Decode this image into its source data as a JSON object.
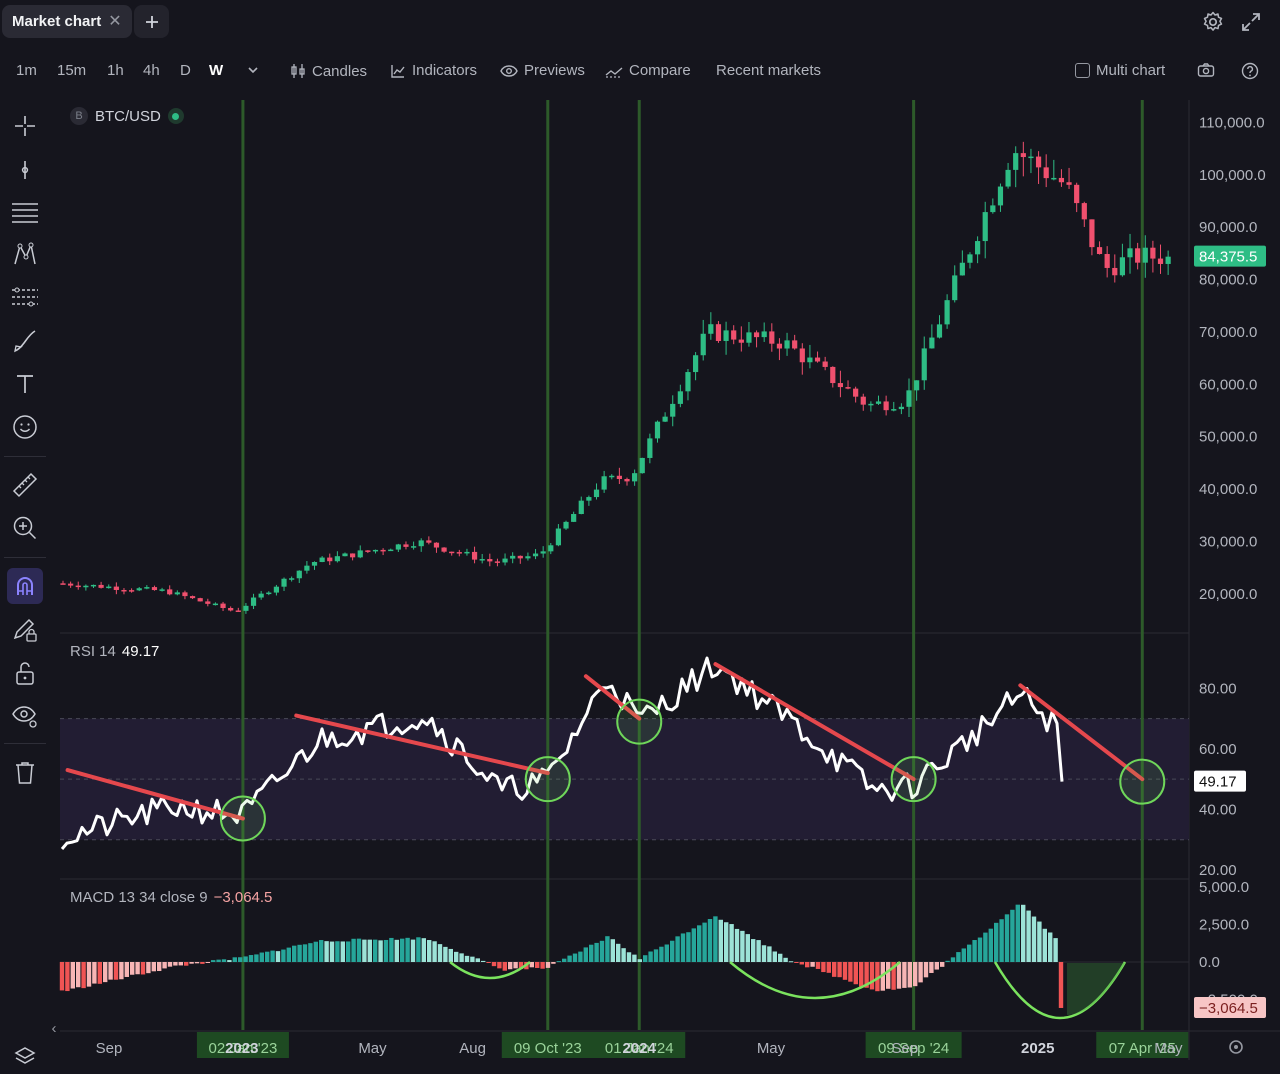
{
  "tab": {
    "title": "Market chart",
    "close": "✕",
    "add": "+"
  },
  "timeframes": [
    "1m",
    "15m",
    "1h",
    "4h",
    "D",
    "W"
  ],
  "active_timeframe": "W",
  "toolbar": {
    "candles": "Candles",
    "indicators": "Indicators",
    "previews": "Previews",
    "compare": "Compare",
    "recent_markets": "Recent markets",
    "multi_chart": "Multi chart"
  },
  "symbol": {
    "badge": "B",
    "name": "BTC/USD"
  },
  "price_axis": {
    "ticks": [
      "110,000.0",
      "100,000.0",
      "90,000.0",
      "80,000.0",
      "70,000.0",
      "60,000.0",
      "50,000.0",
      "40,000.0",
      "30,000.0",
      "20,000.0"
    ],
    "last_price": "84,375.5"
  },
  "rsi": {
    "label": "RSI 14",
    "value": "49.17",
    "ticks": [
      "80.00",
      "60.00",
      "40.00",
      "20.00"
    ]
  },
  "macd": {
    "label": "MACD 13 34 close 9",
    "value": "−3,064.5",
    "axis_value": "−3,064.5",
    "ticks": [
      "5,000.0",
      "2,500.0",
      "0.0",
      "−2,500.0"
    ]
  },
  "time_axis": {
    "labels": [
      "Sep",
      "2023",
      "May",
      "Aug",
      "2024",
      "May",
      "Sep",
      "2025",
      "May"
    ],
    "markers": [
      "02 Jan '23",
      "09 Oct '23",
      "01 Jan '24",
      "09 Sep '24",
      "07 Apr '25"
    ]
  },
  "colors": {
    "bull": "#2ebd85",
    "bear": "#f0506e",
    "signal": "#2d5a2a",
    "trend": "#e5484d",
    "circle": "#6fd65a",
    "rsi_line": "#ffffff",
    "last_price_bg": "#2ebd85"
  },
  "chart_data": [
    {
      "type": "candlestick",
      "title": "BTC/USD",
      "series": [
        {
          "name": "BTC/USD",
          "x": [
            "2022-07-25",
            "2022-10-31",
            "2023-01-02",
            "2023-03-13",
            "2023-06-19",
            "2023-08-28",
            "2023-10-09",
            "2023-12-04",
            "2024-01-01",
            "2024-03-11",
            "2024-05-20",
            "2024-08-05",
            "2024-09-09",
            "2024-11-11",
            "2024-12-16",
            "2025-02-03",
            "2025-03-10",
            "2025-04-07"
          ],
          "close": [
            22000,
            20500,
            16600,
            26000,
            30000,
            26000,
            27500,
            41500,
            42500,
            70000,
            68000,
            56000,
            57000,
            88000,
            105000,
            98000,
            82000,
            84375.5
          ]
        }
      ],
      "ylim": [
        15000,
        112000
      ]
    },
    {
      "type": "line",
      "title": "RSI 14",
      "series": [
        {
          "name": "RSI 14",
          "x": [
            "2022-07-25",
            "2022-10-31",
            "2023-01-02",
            "2023-03-13",
            "2023-06-19",
            "2023-08-28",
            "2023-10-09",
            "2023-12-04",
            "2024-01-01",
            "2024-03-11",
            "2024-05-20",
            "2024-08-05",
            "2024-09-09",
            "2024-11-11",
            "2024-12-16",
            "2025-02-03",
            "2025-03-10",
            "2025-04-07"
          ],
          "values": [
            31,
            41,
            38,
            63,
            71,
            46,
            50,
            84,
            69,
            88,
            69,
            46,
            48,
            67,
            78,
            62,
            45,
            49.17
          ]
        }
      ],
      "ylim": [
        20,
        92
      ]
    },
    {
      "type": "bar",
      "title": "MACD 13 34 close 9",
      "series": [
        {
          "name": "MACD 13 34 close 9",
          "x": [
            "2022-07-25",
            "2022-10-31",
            "2023-01-02",
            "2023-03-13",
            "2023-06-19",
            "2023-08-28",
            "2023-10-09",
            "2023-12-04",
            "2024-01-01",
            "2024-03-11",
            "2024-05-20",
            "2024-08-05",
            "2024-09-09",
            "2024-11-11",
            "2024-12-16",
            "2025-02-03",
            "2025-03-10",
            "2025-04-07"
          ],
          "values": [
            -1900,
            -300,
            300,
            1400,
            1600,
            -500,
            -400,
            1700,
            200,
            3100,
            100,
            -1900,
            -1700,
            1800,
            4000,
            300,
            -2900,
            -3064.5
          ]
        }
      ],
      "ylim": [
        -3500,
        5200
      ]
    }
  ]
}
